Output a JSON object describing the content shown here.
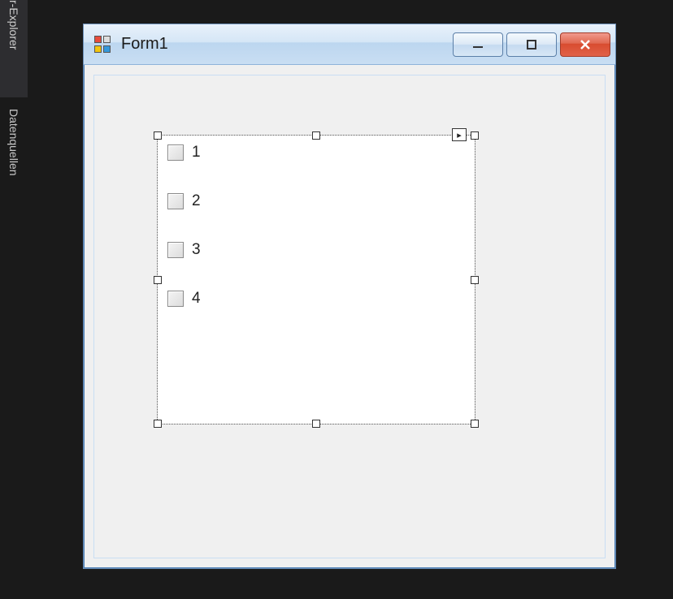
{
  "side_tabs": {
    "0": "r-Explorer",
    "1": "Datenquellen"
  },
  "form": {
    "title": "Form1"
  },
  "checkboxes": {
    "items": [
      {
        "label": "1"
      },
      {
        "label": "2"
      },
      {
        "label": "3"
      },
      {
        "label": "4"
      }
    ]
  }
}
